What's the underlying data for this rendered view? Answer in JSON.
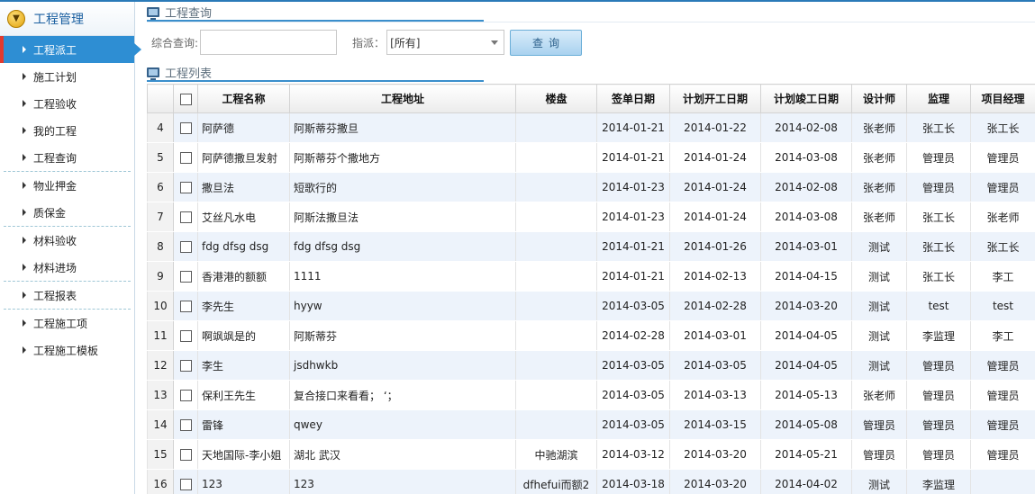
{
  "sidebar": {
    "title": "工程管理",
    "items": [
      {
        "label": "工程派工",
        "active": true,
        "sep_after": false
      },
      {
        "label": "施工计划",
        "active": false,
        "sep_after": false
      },
      {
        "label": "工程验收",
        "active": false,
        "sep_after": false
      },
      {
        "label": "我的工程",
        "active": false,
        "sep_after": false
      },
      {
        "label": "工程查询",
        "active": false,
        "sep_after": true
      },
      {
        "label": "物业押金",
        "active": false,
        "sep_after": false
      },
      {
        "label": "质保金",
        "active": false,
        "sep_after": true
      },
      {
        "label": "材料验收",
        "active": false,
        "sep_after": false
      },
      {
        "label": "材料进场",
        "active": false,
        "sep_after": true
      },
      {
        "label": "工程报表",
        "active": false,
        "sep_after": true
      },
      {
        "label": "工程施工项",
        "active": false,
        "sep_after": false
      },
      {
        "label": "工程施工模板",
        "active": false,
        "sep_after": false
      }
    ]
  },
  "query": {
    "section_title": "工程查询",
    "search_label": "综合查询:",
    "search_value": "",
    "assign_label": "指派：",
    "assign_value": "[所有]",
    "button_label": "查询"
  },
  "list": {
    "section_title": "工程列表",
    "columns": [
      "工程名称",
      "工程地址",
      "楼盘",
      "签单日期",
      "计划开工日期",
      "计划竣工日期",
      "设计师",
      "监理",
      "项目经理"
    ],
    "rows": [
      {
        "num": "4",
        "name": "阿萨德",
        "address": "阿斯蒂芬撒旦",
        "estate": "",
        "sign_date": "2014-01-21",
        "start_date": "2014-01-22",
        "end_date": "2014-02-08",
        "designer": "张老师",
        "supervisor": "张工长",
        "manager": "张工长"
      },
      {
        "num": "5",
        "name": "阿萨德撒旦发射",
        "address": "阿斯蒂芬个撒地方",
        "estate": "",
        "sign_date": "2014-01-21",
        "start_date": "2014-01-24",
        "end_date": "2014-03-08",
        "designer": "张老师",
        "supervisor": "管理员",
        "manager": "管理员"
      },
      {
        "num": "6",
        "name": "撒旦法",
        "address": "短歌行的",
        "estate": "",
        "sign_date": "2014-01-23",
        "start_date": "2014-01-24",
        "end_date": "2014-02-08",
        "designer": "张老师",
        "supervisor": "管理员",
        "manager": "管理员"
      },
      {
        "num": "7",
        "name": "艾丝凡水电",
        "address": "阿斯法撒旦法",
        "estate": "",
        "sign_date": "2014-01-23",
        "start_date": "2014-01-24",
        "end_date": "2014-03-08",
        "designer": "张老师",
        "supervisor": "张工长",
        "manager": "张老师"
      },
      {
        "num": "8",
        "name": "fdg dfsg dsg",
        "address": "fdg dfsg dsg",
        "estate": "",
        "sign_date": "2014-01-21",
        "start_date": "2014-01-26",
        "end_date": "2014-03-01",
        "designer": "测试",
        "supervisor": "张工长",
        "manager": "张工长"
      },
      {
        "num": "9",
        "name": "香港港的额额",
        "address": "1111",
        "estate": "",
        "sign_date": "2014-01-21",
        "start_date": "2014-02-13",
        "end_date": "2014-04-15",
        "designer": "测试",
        "supervisor": "张工长",
        "manager": "李工"
      },
      {
        "num": "10",
        "name": "李先生",
        "address": "hyyw",
        "estate": "",
        "sign_date": "2014-03-05",
        "start_date": "2014-02-28",
        "end_date": "2014-03-20",
        "designer": "测试",
        "supervisor": "test",
        "manager": "test"
      },
      {
        "num": "11",
        "name": "啊飒飒是的",
        "address": "阿斯蒂芬",
        "estate": "",
        "sign_date": "2014-02-28",
        "start_date": "2014-03-01",
        "end_date": "2014-04-05",
        "designer": "测试",
        "supervisor": "李监理",
        "manager": "李工"
      },
      {
        "num": "12",
        "name": "李生",
        "address": "jsdhwkb",
        "estate": "",
        "sign_date": "2014-03-05",
        "start_date": "2014-03-05",
        "end_date": "2014-04-05",
        "designer": "测试",
        "supervisor": "管理员",
        "manager": "管理员"
      },
      {
        "num": "13",
        "name": "保利王先生",
        "address": "复合接口来看看； ‘；",
        "estate": "",
        "sign_date": "2014-03-05",
        "start_date": "2014-03-13",
        "end_date": "2014-05-13",
        "designer": "张老师",
        "supervisor": "管理员",
        "manager": "管理员"
      },
      {
        "num": "14",
        "name": "雷锋",
        "address": "qwey",
        "estate": "",
        "sign_date": "2014-03-05",
        "start_date": "2014-03-15",
        "end_date": "2014-05-08",
        "designer": "管理员",
        "supervisor": "管理员",
        "manager": "管理员"
      },
      {
        "num": "15",
        "name": "天地国际-李小姐",
        "address": "湖北 武汉",
        "estate": "中驰湖滨",
        "sign_date": "2014-03-12",
        "start_date": "2014-03-20",
        "end_date": "2014-05-21",
        "designer": "管理员",
        "supervisor": "管理员",
        "manager": "管理员"
      },
      {
        "num": "16",
        "name": "123",
        "address": "123",
        "estate": "dfhefui而额2",
        "sign_date": "2014-03-18",
        "start_date": "2014-03-20",
        "end_date": "2014-04-02",
        "designer": "测试",
        "supervisor": "李监理",
        "manager": ""
      }
    ]
  }
}
